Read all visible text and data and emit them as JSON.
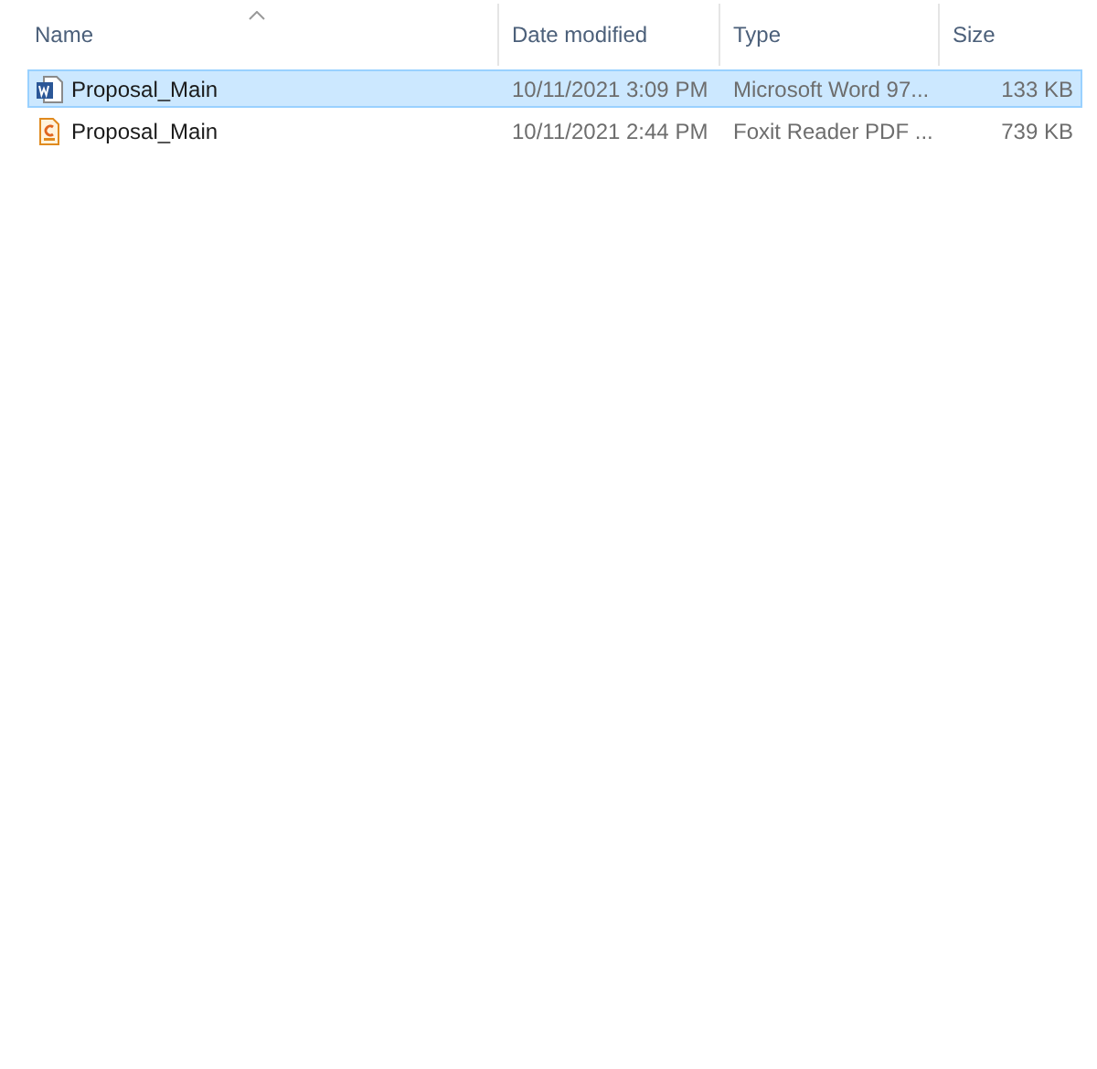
{
  "columns": [
    {
      "label": "Name",
      "sorted": true
    },
    {
      "label": "Date modified",
      "sorted": false
    },
    {
      "label": "Type",
      "sorted": false
    },
    {
      "label": "Size",
      "sorted": false
    }
  ],
  "rows": [
    {
      "kind": "word",
      "name": "Proposal_Main",
      "date": "10/11/2021 3:09 PM",
      "type": "Microsoft Word 97...",
      "size": "133 KB",
      "selected": true
    },
    {
      "kind": "pdf",
      "name": "Proposal_Main",
      "date": "10/11/2021 2:44 PM",
      "type": "Foxit Reader PDF ...",
      "size": "739 KB",
      "selected": false
    }
  ]
}
